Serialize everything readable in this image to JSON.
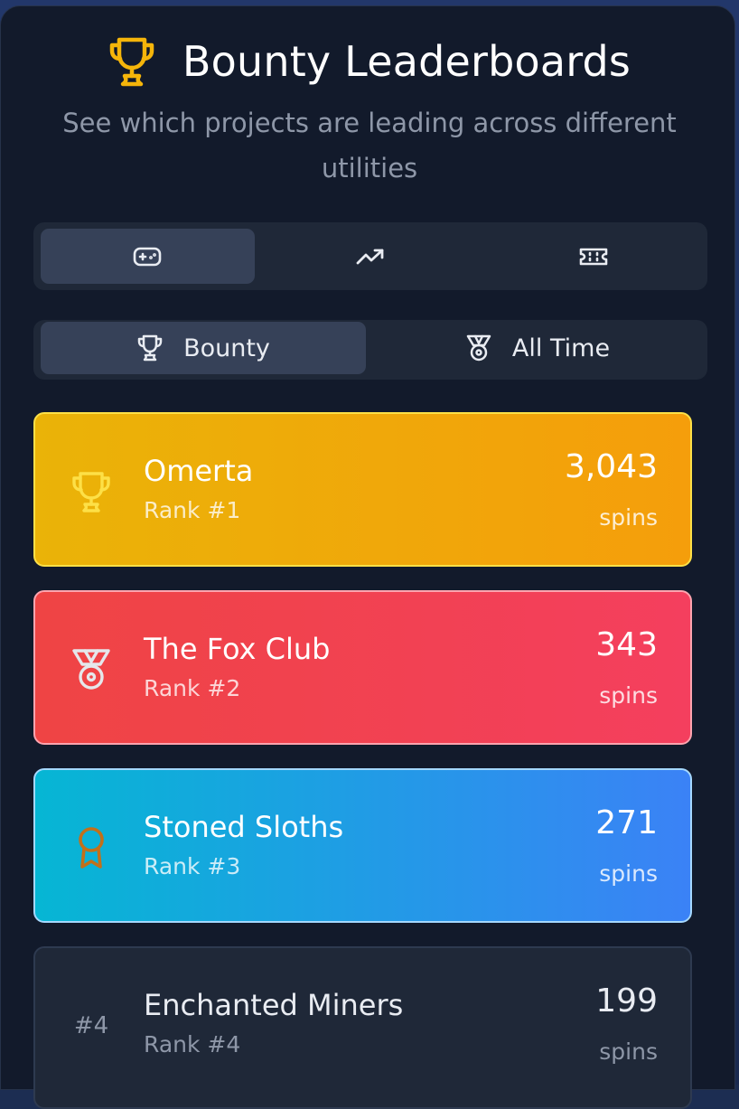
{
  "header": {
    "title": "Bounty Leaderboards",
    "subtitle": "See which projects are leading across different utilities",
    "icon": "trophy-icon",
    "accent": "#f5b50a"
  },
  "utility_tabs": [
    {
      "icon": "gamepad-icon",
      "active": true
    },
    {
      "icon": "trending-up-icon",
      "active": false
    },
    {
      "icon": "ticket-icon",
      "active": false
    }
  ],
  "period_tabs": [
    {
      "label": "Bounty",
      "icon": "trophy-icon",
      "active": true
    },
    {
      "label": "All Time",
      "icon": "medal-icon",
      "active": false
    }
  ],
  "leaderboard": [
    {
      "name": "Omerta",
      "rank": "Rank #1",
      "value": "3,043",
      "unit": "spins",
      "icon": "trophy-icon",
      "color": "#eab308"
    },
    {
      "name": "The Fox Club",
      "rank": "Rank #2",
      "value": "343",
      "unit": "spins",
      "icon": "medal-icon",
      "color": "#ef4444"
    },
    {
      "name": "Stoned Sloths",
      "rank": "Rank #3",
      "value": "271",
      "unit": "spins",
      "icon": "award-icon",
      "color": "#06b6d4"
    },
    {
      "name": "Enchanted Miners",
      "rank": "Rank #4",
      "value": "199",
      "unit": "spins",
      "badge": "#4",
      "color": "#1f2838"
    }
  ]
}
